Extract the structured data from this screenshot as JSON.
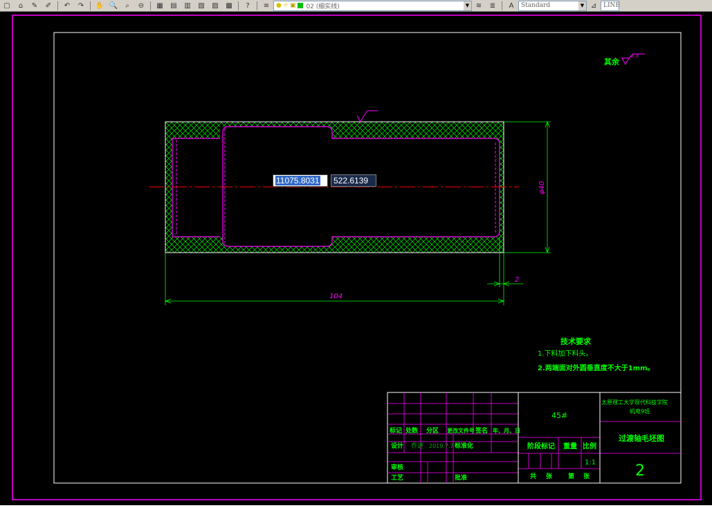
{
  "toolbar": {
    "layer_name": "02 (细实线)",
    "text_style": "Standard",
    "linetype": "LINE"
  },
  "dynamic_input": {
    "x": "11075.8031",
    "y": "522.6139"
  },
  "drawing": {
    "roughness_note": "其余",
    "roughness_value": "6.3",
    "dim_diameter": "φ40",
    "dim_length": "104",
    "dim_small": "2"
  },
  "tech_requirements": {
    "title": "技术要求",
    "line1": "1.下料加下料头。",
    "line2": "2.两端面对外圆垂直度不大于1mm。"
  },
  "title_block": {
    "material": "45#",
    "school": "太原理工大学现代科技学院",
    "class": "机电9班",
    "drawing_name": "过渡轴毛坯图",
    "number": "2",
    "scale": "1:1",
    "headers": [
      "标记",
      "处数",
      "分区",
      "更改文件号",
      "签名",
      "年、月、日"
    ],
    "design": "设计",
    "designer": "乔进",
    "date": "2019.7.7",
    "standardize": "标准化",
    "stage": "阶段标记",
    "weight": "重量",
    "ratio": "比例",
    "review": "审核",
    "craft": "工艺",
    "approve": "批准",
    "sheets_total": "共",
    "sheets_label": "张",
    "sheet_no": "第",
    "sheet_label": "张"
  },
  "colors": {
    "frame": "#ff00ff",
    "lines": "#ffffff",
    "dims": "#00ff00",
    "hatch": "#00ff00",
    "center": "#ff0000",
    "text": "#00ff00"
  }
}
